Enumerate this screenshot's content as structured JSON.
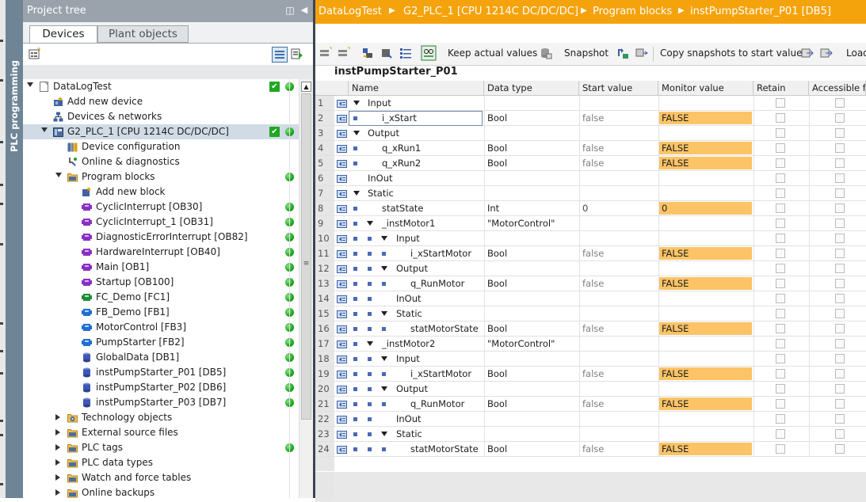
{
  "tree": {
    "title": "Project tree",
    "tabs": [
      "Devices",
      "Plant objects"
    ],
    "items": [
      {
        "label": "DataLogTest",
        "indent": 0,
        "arrow": "down",
        "icon": "project-icon",
        "check": true,
        "dot": true
      },
      {
        "label": "Add new device",
        "indent": 1,
        "arrow": "",
        "icon": "add-new-device-icon",
        "check": false,
        "dot": false
      },
      {
        "label": "Devices & networks",
        "indent": 1,
        "arrow": "",
        "icon": "network-icon",
        "check": false,
        "dot": false
      },
      {
        "label": "G2_PLC_1 [CPU 1214C DC/DC/DC]",
        "indent": 1,
        "arrow": "down",
        "icon": "plc-icon",
        "check": true,
        "dot": true,
        "selected": true
      },
      {
        "label": "Device configuration",
        "indent": 2,
        "arrow": "",
        "icon": "device-config-icon",
        "check": false,
        "dot": false
      },
      {
        "label": "Online & diagnostics",
        "indent": 2,
        "arrow": "",
        "icon": "diagnostics-icon",
        "check": false,
        "dot": false
      },
      {
        "label": "Program blocks",
        "indent": 2,
        "arrow": "down",
        "icon": "folder-icon",
        "check": false,
        "dot": true
      },
      {
        "label": "Add new block",
        "indent": 3,
        "arrow": "",
        "icon": "add-new-block-icon",
        "check": false,
        "dot": false
      },
      {
        "label": "CyclicInterrupt [OB30]",
        "indent": 3,
        "arrow": "",
        "icon": "ob-block-icon",
        "check": false,
        "dot": true
      },
      {
        "label": "CyclicInterrupt_1 [OB31]",
        "indent": 3,
        "arrow": "",
        "icon": "ob-block-icon",
        "check": false,
        "dot": true
      },
      {
        "label": "DiagnosticErrorInterrupt [OB82]",
        "indent": 3,
        "arrow": "",
        "icon": "ob-block-icon",
        "check": false,
        "dot": true
      },
      {
        "label": "HardwareInterrupt [OB40]",
        "indent": 3,
        "arrow": "",
        "icon": "ob-block-icon",
        "check": false,
        "dot": true
      },
      {
        "label": "Main [OB1]",
        "indent": 3,
        "arrow": "",
        "icon": "ob-block-icon",
        "check": false,
        "dot": true
      },
      {
        "label": "Startup [OB100]",
        "indent": 3,
        "arrow": "",
        "icon": "ob-block-icon",
        "check": false,
        "dot": true
      },
      {
        "label": "FC_Demo [FC1]",
        "indent": 3,
        "arrow": "",
        "icon": "fc-block-icon",
        "check": false,
        "dot": true
      },
      {
        "label": "FB_Demo [FB1]",
        "indent": 3,
        "arrow": "",
        "icon": "fb-block-icon",
        "check": false,
        "dot": true
      },
      {
        "label": "MotorControl [FB3]",
        "indent": 3,
        "arrow": "",
        "icon": "fb-block-icon",
        "check": false,
        "dot": true
      },
      {
        "label": "PumpStarter [FB2]",
        "indent": 3,
        "arrow": "",
        "icon": "fb-block-icon",
        "check": false,
        "dot": true
      },
      {
        "label": "GlobalData [DB1]",
        "indent": 3,
        "arrow": "",
        "icon": "db-block-icon",
        "check": false,
        "dot": true
      },
      {
        "label": "instPumpStarter_P01 [DB5]",
        "indent": 3,
        "arrow": "",
        "icon": "db-block-icon",
        "check": false,
        "dot": true
      },
      {
        "label": "instPumpStarter_P02 [DB6]",
        "indent": 3,
        "arrow": "",
        "icon": "db-block-icon",
        "check": false,
        "dot": true
      },
      {
        "label": "instPumpStarter_P03 [DB7]",
        "indent": 3,
        "arrow": "",
        "icon": "db-block-icon",
        "check": false,
        "dot": true
      },
      {
        "label": "Technology objects",
        "indent": 2,
        "arrow": "right",
        "icon": "technology-icon",
        "check": false,
        "dot": false
      },
      {
        "label": "External source files",
        "indent": 2,
        "arrow": "right",
        "icon": "folder-icon",
        "check": false,
        "dot": false
      },
      {
        "label": "PLC tags",
        "indent": 2,
        "arrow": "right",
        "icon": "folder-icon",
        "check": false,
        "dot": true
      },
      {
        "label": "PLC data types",
        "indent": 2,
        "arrow": "right",
        "icon": "folder-icon",
        "check": false,
        "dot": false
      },
      {
        "label": "Watch and force tables",
        "indent": 2,
        "arrow": "right",
        "icon": "folder-icon",
        "check": false,
        "dot": false
      },
      {
        "label": "Online backups",
        "indent": 2,
        "arrow": "right",
        "icon": "folder-icon",
        "check": false,
        "dot": false
      }
    ]
  },
  "sidebar": {
    "label": "PLC programming"
  },
  "breadcrumb": [
    "DataLogTest",
    "G2_PLC_1 [CPU 1214C DC/DC/DC]",
    "Program blocks",
    "instPumpStarter_P01 [DB5]"
  ],
  "toolbar": {
    "keep_actual": "Keep actual values",
    "snapshot": "Snapshot",
    "copy_snapshots": "Copy snapshots to start values",
    "load": "Load"
  },
  "block_title": "instPumpStarter_P01",
  "columns": [
    "Name",
    "Data type",
    "Start value",
    "Monitor value",
    "Retain",
    "Accessible f..."
  ],
  "rows": [
    {
      "num": "1",
      "level": 0,
      "arrow": "down",
      "bullet": false,
      "name": "Input",
      "type": "",
      "start": "",
      "monitor": ""
    },
    {
      "num": "2",
      "level": 1,
      "arrow": "",
      "bullet": true,
      "name": "i_xStart",
      "type": "Bool",
      "start": "false",
      "monitor": "FALSE",
      "selected": true
    },
    {
      "num": "3",
      "level": 0,
      "arrow": "down",
      "bullet": false,
      "name": "Output",
      "type": "",
      "start": "",
      "monitor": ""
    },
    {
      "num": "4",
      "level": 1,
      "arrow": "",
      "bullet": true,
      "name": "q_xRun1",
      "type": "Bool",
      "start": "false",
      "monitor": "FALSE"
    },
    {
      "num": "5",
      "level": 1,
      "arrow": "",
      "bullet": true,
      "name": "q_xRun2",
      "type": "Bool",
      "start": "false",
      "monitor": "FALSE"
    },
    {
      "num": "6",
      "level": 0,
      "arrow": "",
      "bullet": false,
      "name": "InOut",
      "type": "",
      "start": "",
      "monitor": ""
    },
    {
      "num": "7",
      "level": 0,
      "arrow": "down",
      "bullet": false,
      "name": "Static",
      "type": "",
      "start": "",
      "monitor": ""
    },
    {
      "num": "8",
      "level": 1,
      "arrow": "",
      "bullet": true,
      "name": "statState",
      "type": "Int",
      "start": "0",
      "monitor": "0"
    },
    {
      "num": "9",
      "level": 1,
      "arrow": "down",
      "bullet": true,
      "name": "_instMotor1",
      "type": "\"MotorControl\"",
      "start": "",
      "monitor": ""
    },
    {
      "num": "10",
      "level": 2,
      "arrow": "down",
      "bullet": true,
      "name": "Input",
      "type": "",
      "start": "",
      "monitor": ""
    },
    {
      "num": "11",
      "level": 3,
      "arrow": "",
      "bullet": true,
      "name": "i_xStartMotor",
      "type": "Bool",
      "start": "false",
      "monitor": "FALSE"
    },
    {
      "num": "12",
      "level": 2,
      "arrow": "down",
      "bullet": true,
      "name": "Output",
      "type": "",
      "start": "",
      "monitor": ""
    },
    {
      "num": "13",
      "level": 3,
      "arrow": "",
      "bullet": true,
      "name": "q_RunMotor",
      "type": "Bool",
      "start": "false",
      "monitor": "FALSE"
    },
    {
      "num": "14",
      "level": 2,
      "arrow": "",
      "bullet": true,
      "name": "InOut",
      "type": "",
      "start": "",
      "monitor": ""
    },
    {
      "num": "15",
      "level": 2,
      "arrow": "down",
      "bullet": true,
      "name": "Static",
      "type": "",
      "start": "",
      "monitor": ""
    },
    {
      "num": "16",
      "level": 3,
      "arrow": "",
      "bullet": true,
      "name": "statMotorState",
      "type": "Bool",
      "start": "false",
      "monitor": "FALSE"
    },
    {
      "num": "17",
      "level": 1,
      "arrow": "down",
      "bullet": true,
      "name": "_instMotor2",
      "type": "\"MotorControl\"",
      "start": "",
      "monitor": ""
    },
    {
      "num": "18",
      "level": 2,
      "arrow": "down",
      "bullet": true,
      "name": "Input",
      "type": "",
      "start": "",
      "monitor": ""
    },
    {
      "num": "19",
      "level": 3,
      "arrow": "",
      "bullet": true,
      "name": "i_xStartMotor",
      "type": "Bool",
      "start": "false",
      "monitor": "FALSE"
    },
    {
      "num": "20",
      "level": 2,
      "arrow": "down",
      "bullet": true,
      "name": "Output",
      "type": "",
      "start": "",
      "monitor": ""
    },
    {
      "num": "21",
      "level": 3,
      "arrow": "",
      "bullet": true,
      "name": "q_RunMotor",
      "type": "Bool",
      "start": "false",
      "monitor": "FALSE"
    },
    {
      "num": "22",
      "level": 2,
      "arrow": "",
      "bullet": true,
      "name": "InOut",
      "type": "",
      "start": "",
      "monitor": ""
    },
    {
      "num": "23",
      "level": 2,
      "arrow": "down",
      "bullet": true,
      "name": "Static",
      "type": "",
      "start": "",
      "monitor": ""
    },
    {
      "num": "24",
      "level": 3,
      "arrow": "",
      "bullet": true,
      "name": "statMotorState",
      "type": "Bool",
      "start": "false",
      "monitor": "FALSE"
    }
  ],
  "colors": {
    "accent": "#f5a30c",
    "monitor_highlight": "#fcc466",
    "status_ok": "#1ba51b",
    "sidebar": "#6f8596"
  }
}
